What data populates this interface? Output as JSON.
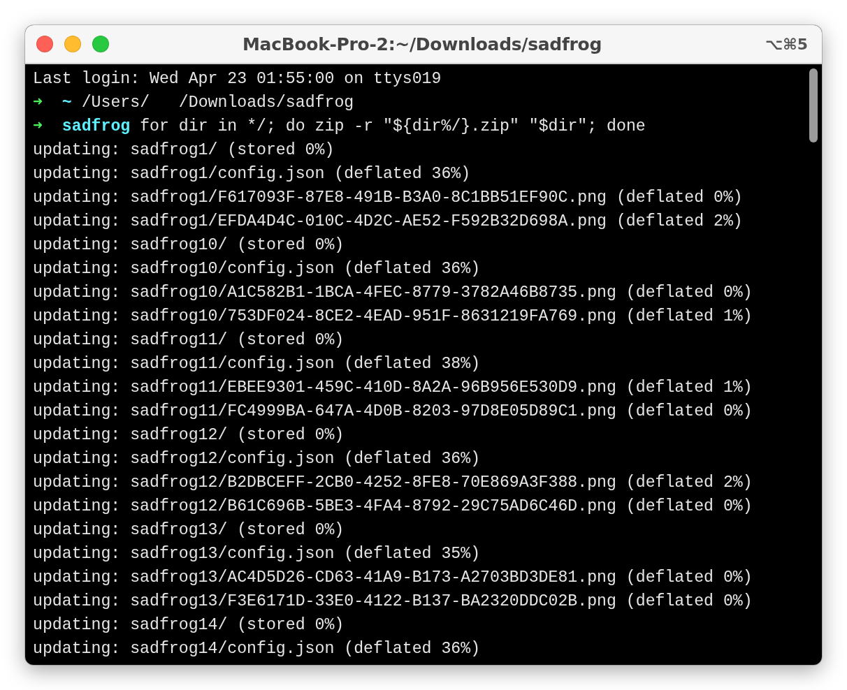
{
  "window": {
    "title": "MacBook-Pro-2:~/Downloads/sadfrog",
    "shortcut": "⌥⌘5"
  },
  "lines": [
    {
      "kind": "text",
      "text": "Last login: Wed Apr 23 01:55:00 on ttys019"
    },
    {
      "kind": "prompt",
      "arrow": "➜",
      "dir": "~",
      "command": "/Users/   /Downloads/sadfrog"
    },
    {
      "kind": "prompt",
      "arrow": "➜",
      "dir": "sadfrog",
      "command": "for dir in */; do zip -r \"${dir%/}.zip\" \"$dir\"; done"
    },
    {
      "kind": "text",
      "text": "updating: sadfrog1/ (stored 0%)"
    },
    {
      "kind": "text",
      "text": "updating: sadfrog1/config.json (deflated 36%)"
    },
    {
      "kind": "text",
      "text": "updating: sadfrog1/F617093F-87E8-491B-B3A0-8C1BB51EF90C.png (deflated 0%)"
    },
    {
      "kind": "text",
      "text": "updating: sadfrog1/EFDA4D4C-010C-4D2C-AE52-F592B32D698A.png (deflated 2%)"
    },
    {
      "kind": "text",
      "text": "updating: sadfrog10/ (stored 0%)"
    },
    {
      "kind": "text",
      "text": "updating: sadfrog10/config.json (deflated 36%)"
    },
    {
      "kind": "text",
      "text": "updating: sadfrog10/A1C582B1-1BCA-4FEC-8779-3782A46B8735.png (deflated 0%)"
    },
    {
      "kind": "text",
      "text": "updating: sadfrog10/753DF024-8CE2-4EAD-951F-8631219FA769.png (deflated 1%)"
    },
    {
      "kind": "text",
      "text": "updating: sadfrog11/ (stored 0%)"
    },
    {
      "kind": "text",
      "text": "updating: sadfrog11/config.json (deflated 38%)"
    },
    {
      "kind": "text",
      "text": "updating: sadfrog11/EBEE9301-459C-410D-8A2A-96B956E530D9.png (deflated 1%)"
    },
    {
      "kind": "text",
      "text": "updating: sadfrog11/FC4999BA-647A-4D0B-8203-97D8E05D89C1.png (deflated 0%)"
    },
    {
      "kind": "text",
      "text": "updating: sadfrog12/ (stored 0%)"
    },
    {
      "kind": "text",
      "text": "updating: sadfrog12/config.json (deflated 36%)"
    },
    {
      "kind": "text",
      "text": "updating: sadfrog12/B2DBCEFF-2CB0-4252-8FE8-70E869A3F388.png (deflated 2%)"
    },
    {
      "kind": "text",
      "text": "updating: sadfrog12/B61C696B-5BE3-4FA4-8792-29C75AD6C46D.png (deflated 0%)"
    },
    {
      "kind": "text",
      "text": "updating: sadfrog13/ (stored 0%)"
    },
    {
      "kind": "text",
      "text": "updating: sadfrog13/config.json (deflated 35%)"
    },
    {
      "kind": "text",
      "text": "updating: sadfrog13/AC4D5D26-CD63-41A9-B173-A2703BD3DE81.png (deflated 0%)"
    },
    {
      "kind": "text",
      "text": "updating: sadfrog13/F3E6171D-33E0-4122-B137-BA2320DDC02B.png (deflated 0%)"
    },
    {
      "kind": "text",
      "text": "updating: sadfrog14/ (stored 0%)"
    },
    {
      "kind": "text",
      "text": "updating: sadfrog14/config.json (deflated 36%)"
    }
  ]
}
